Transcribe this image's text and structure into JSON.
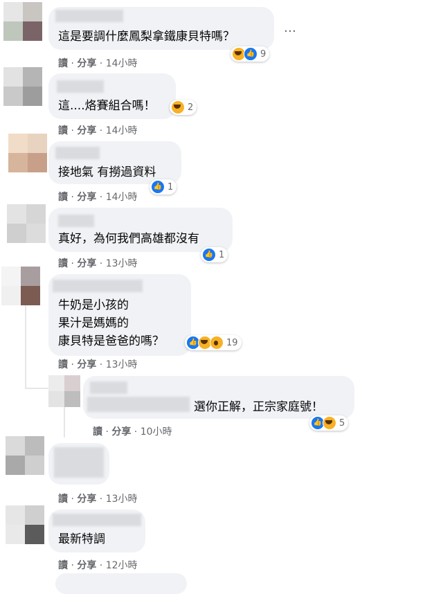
{
  "more_icon": "…",
  "comments": [
    {
      "text": "這是要調什麼鳳梨拿鐵康貝特嗎？",
      "actions": {
        "read": "讀",
        "share": "分享",
        "time": "14小時"
      },
      "reactions": {
        "types": [
          "haha",
          "like"
        ],
        "count": "9"
      }
    },
    {
      "text": "這....烙賽組合嗎！",
      "actions": {
        "read": "讀",
        "share": "分享",
        "time": "14小時"
      },
      "reactions": {
        "types": [
          "haha"
        ],
        "count": "2"
      }
    },
    {
      "text": "接地氣 有撈過資料",
      "actions": {
        "read": "讀",
        "share": "分享",
        "time": "14小時"
      },
      "reactions": {
        "types": [
          "like"
        ],
        "count": "1"
      }
    },
    {
      "text": "真好，為何我們高雄都沒有",
      "actions": {
        "read": "讀",
        "share": "分享",
        "time": "13小時"
      },
      "reactions": {
        "types": [
          "like"
        ],
        "count": "1"
      }
    },
    {
      "lines": [
        "牛奶是小孩的",
        "果汁是媽媽的",
        "康貝特是爸爸的嗎？"
      ],
      "actions": {
        "read": "讀",
        "share": "分享",
        "time": "13小時"
      },
      "reactions": {
        "types": [
          "like",
          "haha",
          "wow"
        ],
        "count": "19"
      }
    },
    {
      "text": "選你正解，正宗家庭號！",
      "actions": {
        "read": "讀",
        "share": "分享",
        "time": "10小時"
      },
      "reactions": {
        "types": [
          "like",
          "haha"
        ],
        "count": "5"
      }
    },
    {
      "text": "",
      "actions": {
        "read": "讀",
        "share": "分享",
        "time": "13小時"
      }
    },
    {
      "text": "最新特調",
      "actions": {
        "read": "讀",
        "share": "分享",
        "time": "12小時"
      }
    }
  ]
}
